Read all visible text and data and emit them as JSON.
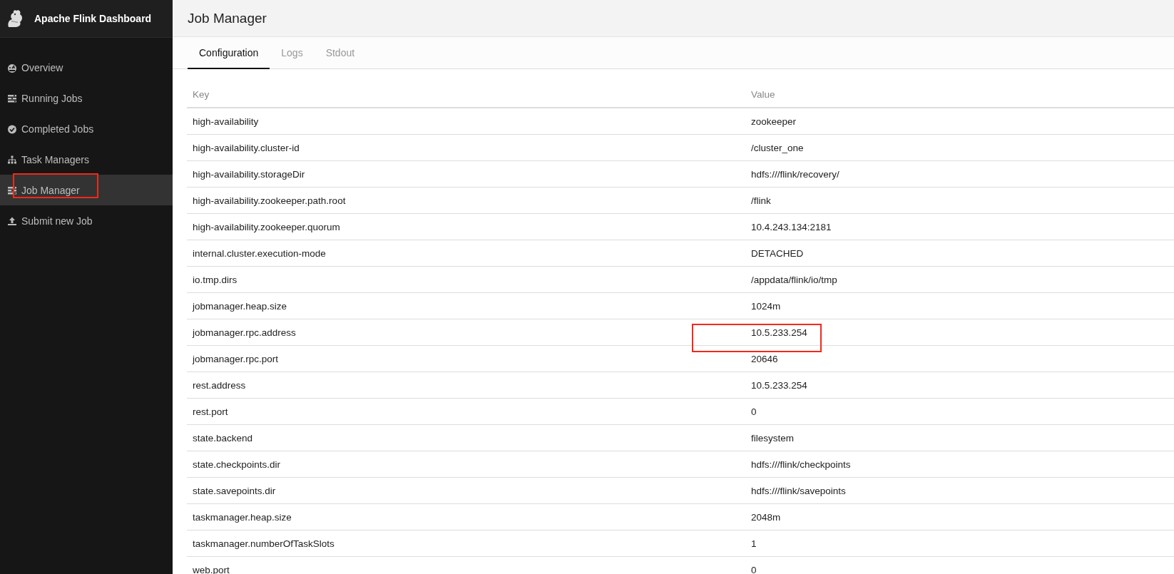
{
  "brand": {
    "title": "Apache Flink Dashboard"
  },
  "sidebar": {
    "items": [
      {
        "label": "Overview",
        "selected": false,
        "highlighted": false
      },
      {
        "label": "Running Jobs",
        "selected": false,
        "highlighted": false
      },
      {
        "label": "Completed Jobs",
        "selected": false,
        "highlighted": false
      },
      {
        "label": "Task Managers",
        "selected": false,
        "highlighted": false
      },
      {
        "label": "Job Manager",
        "selected": true,
        "highlighted": true
      },
      {
        "label": "Submit new Job",
        "selected": false,
        "highlighted": false
      }
    ]
  },
  "page": {
    "title": "Job Manager"
  },
  "tabs": [
    {
      "label": "Configuration",
      "selected": true
    },
    {
      "label": "Logs",
      "selected": false
    },
    {
      "label": "Stdout",
      "selected": false
    }
  ],
  "table": {
    "columns": [
      "Key",
      "Value"
    ],
    "rows": [
      {
        "key": "high-availability",
        "value": "zookeeper",
        "highlighted": false
      },
      {
        "key": "high-availability.cluster-id",
        "value": "/cluster_one",
        "highlighted": false
      },
      {
        "key": "high-availability.storageDir",
        "value": "hdfs:///flink/recovery/",
        "highlighted": false
      },
      {
        "key": "high-availability.zookeeper.path.root",
        "value": "/flink",
        "highlighted": false
      },
      {
        "key": "high-availability.zookeeper.quorum",
        "value": "10.4.243.134:2181",
        "highlighted": false
      },
      {
        "key": "internal.cluster.execution-mode",
        "value": "DETACHED",
        "highlighted": false
      },
      {
        "key": "io.tmp.dirs",
        "value": "/appdata/flink/io/tmp",
        "highlighted": false
      },
      {
        "key": "jobmanager.heap.size",
        "value": "1024m",
        "highlighted": false
      },
      {
        "key": "jobmanager.rpc.address",
        "value": "10.5.233.254",
        "highlighted": true
      },
      {
        "key": "jobmanager.rpc.port",
        "value": "20646",
        "highlighted": false
      },
      {
        "key": "rest.address",
        "value": "10.5.233.254",
        "highlighted": false
      },
      {
        "key": "rest.port",
        "value": "0",
        "highlighted": false
      },
      {
        "key": "state.backend",
        "value": "filesystem",
        "highlighted": false
      },
      {
        "key": "state.checkpoints.dir",
        "value": "hdfs:///flink/checkpoints",
        "highlighted": false
      },
      {
        "key": "state.savepoints.dir",
        "value": "hdfs:///flink/savepoints",
        "highlighted": false
      },
      {
        "key": "taskmanager.heap.size",
        "value": "2048m",
        "highlighted": false
      },
      {
        "key": "taskmanager.numberOfTaskSlots",
        "value": "1",
        "highlighted": false
      },
      {
        "key": "web.port",
        "value": "0",
        "highlighted": false
      }
    ]
  }
}
